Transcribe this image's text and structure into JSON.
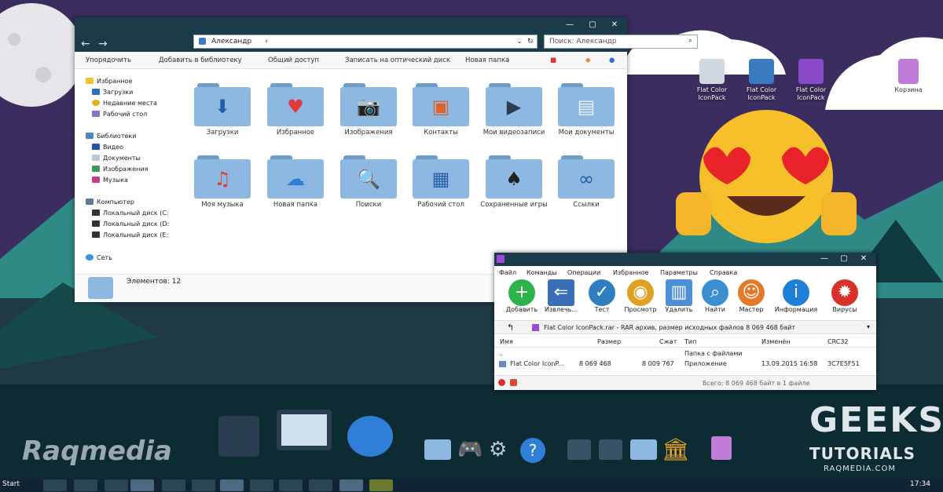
{
  "explorer": {
    "address": "Александр",
    "search_placeholder": "Поиск: Александр",
    "ribbon": [
      "Упорядочить",
      "Добавить в библиотеку",
      "Общий доступ",
      "Записать на оптический диск",
      "Новая папка"
    ],
    "nav_groups": [
      {
        "title": "Избранное",
        "items": [
          "Загрузки",
          "Недавние места",
          "Рабочий стол"
        ]
      },
      {
        "title": "Библиотеки",
        "items": [
          "Видео",
          "Документы",
          "Изображения",
          "Музыка"
        ]
      },
      {
        "title": "Компьютер",
        "items": [
          "Локальный диск (C:",
          "Локальный диск (D:",
          "Локальный диск (E:"
        ]
      },
      {
        "title": "Сеть",
        "items": []
      }
    ],
    "folders": [
      {
        "label": "Загрузки",
        "icon": "download-arrow-icon"
      },
      {
        "label": "Избранное",
        "icon": "heart-icon"
      },
      {
        "label": "Изображения",
        "icon": "camera-icon"
      },
      {
        "label": "Контакты",
        "icon": "contact-card-icon"
      },
      {
        "label": "Мои видеозаписи",
        "icon": "video-camera-icon"
      },
      {
        "label": "Мои документы",
        "icon": "document-icon"
      },
      {
        "label": "Моя музыка",
        "icon": "music-note-icon"
      },
      {
        "label": "Новая папка",
        "icon": "cloud-icon"
      },
      {
        "label": "Поиски",
        "icon": "magnifier-icon"
      },
      {
        "label": "Рабочий стол",
        "icon": "desktop-window-icon"
      },
      {
        "label": "Сохраненные игры",
        "icon": "playing-cards-icon"
      },
      {
        "label": "Ссылки",
        "icon": "chain-link-icon"
      }
    ],
    "status_text": "Элементов: 12"
  },
  "winrar": {
    "menu": [
      "Файл",
      "Команды",
      "Операции",
      "Избранное",
      "Параметры",
      "Справка"
    ],
    "toolbar": [
      {
        "label": "Добавить",
        "icon": "plus-icon",
        "color": "#2db34a"
      },
      {
        "label": "Извлечь...",
        "icon": "extract-arrow-icon",
        "color": "#3a6fb8"
      },
      {
        "label": "Тест",
        "icon": "check-clock-icon",
        "color": "#2f7fc0"
      },
      {
        "label": "Просмотр",
        "icon": "eye-magnifier-icon",
        "color": "#e0a020"
      },
      {
        "label": "Удалить",
        "icon": "trash-icon",
        "color": "#4a8fd8"
      },
      {
        "label": "Найти",
        "icon": "magnifier-icon",
        "color": "#3b8fd0"
      },
      {
        "label": "Мастер",
        "icon": "wizard-person-icon",
        "color": "#e27a2a"
      },
      {
        "label": "Информация",
        "icon": "info-icon",
        "color": "#1e7fd8"
      },
      {
        "label": "Вирусы",
        "icon": "ladybug-icon",
        "color": "#d8302a"
      }
    ],
    "path_text": "Flat Color IconPack.rar - RAR архив, размер исходных файлов 8 069 468 байт",
    "columns": [
      "Имя",
      "Размер",
      "Сжат",
      "Тип",
      "Изменён",
      "CRC32"
    ],
    "rows": [
      {
        "name": "..",
        "size": "",
        "packed": "",
        "type": "Папка с файлами",
        "modified": "",
        "crc": ""
      },
      {
        "name": "Flat Color IconP...",
        "size": "8 069 468",
        "packed": "8 009 767",
        "type": "Приложение",
        "modified": "13.09.2015 16:58",
        "crc": "3C7E5F51"
      }
    ],
    "status_text": "Всего: 8 069 468 байт в 1 файле"
  },
  "desktop_icons": [
    {
      "label": "Flat Color IconPack"
    },
    {
      "label": "Flat Color IconPack"
    },
    {
      "label": "Flat Color IconPack"
    },
    {
      "label": "Корзина"
    }
  ],
  "branding": {
    "left_logo": "Raqmedia",
    "right_logo_line1": "GEEKS",
    "right_logo_line2": "TUTORIALS",
    "right_logo_line3": "RAQMEDIA.COM"
  },
  "taskbar": {
    "start_label": "Start",
    "clock": "17:34"
  }
}
